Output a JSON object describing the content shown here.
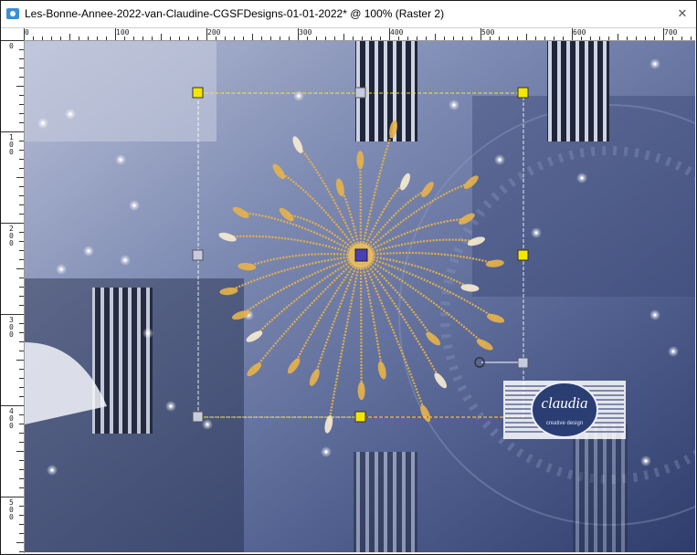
{
  "window": {
    "title": "Les-Bonne-Annee-2022-van-Claudine-CGSFDesigns-01-01-2022* @ 100% (Raster 2)",
    "close_symbol": "✕"
  },
  "rulers": {
    "horizontal_labels": [
      "0",
      "100",
      "200",
      "300",
      "400",
      "500",
      "600",
      "700"
    ],
    "vertical_labels": [
      "0",
      "100",
      "200",
      "300",
      "400",
      "500"
    ]
  },
  "canvas": {
    "watermark_text": "claudia",
    "watermark_subtext": "creative design"
  },
  "colors": {
    "accent_handle": "#f5e600",
    "bounding_box": "#ffffff",
    "firework": "#e7b24a"
  }
}
